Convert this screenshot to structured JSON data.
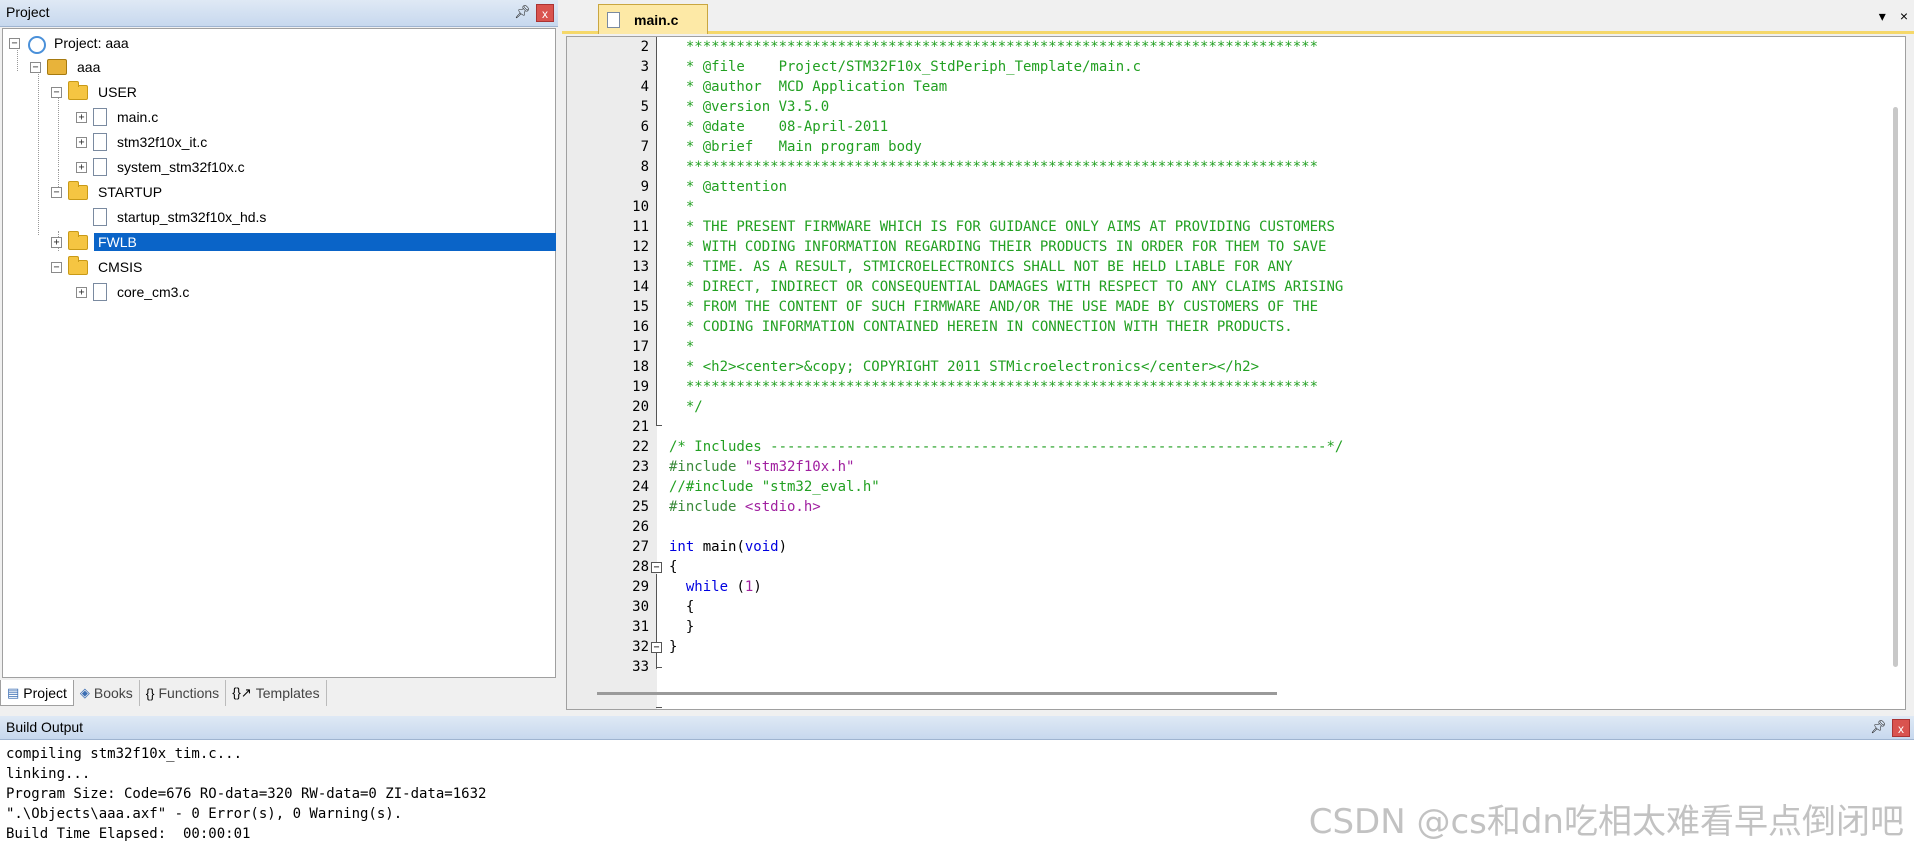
{
  "project_panel": {
    "title": "Project",
    "pin": "p",
    "close": "x",
    "tree": [
      {
        "label": "Project: aaa",
        "icon": "project-icon",
        "expanded": true
      },
      {
        "label": "aaa",
        "icon": "target-icon",
        "expanded": true
      },
      {
        "label": "USER",
        "icon": "folder-icon",
        "expanded": true
      },
      {
        "label": "main.c",
        "icon": "file-icon",
        "expanded": false
      },
      {
        "label": "stm32f10x_it.c",
        "icon": "file-icon",
        "expanded": false
      },
      {
        "label": "system_stm32f10x.c",
        "icon": "file-icon",
        "expanded": false
      },
      {
        "label": "STARTUP",
        "icon": "folder-icon",
        "expanded": true
      },
      {
        "label": "startup_stm32f10x_hd.s",
        "icon": "file-icon"
      },
      {
        "label": "FWLB",
        "icon": "folder-icon",
        "expanded": false,
        "selected": true
      },
      {
        "label": "CMSIS",
        "icon": "folder-icon",
        "expanded": true
      },
      {
        "label": "core_cm3.c",
        "icon": "file-icon",
        "expanded": false
      }
    ],
    "tabs": [
      {
        "label": "Project",
        "icon": "project-tab-icon",
        "active": true
      },
      {
        "label": "Books",
        "icon": "books-icon"
      },
      {
        "label": "Functions",
        "icon": "functions-icon"
      },
      {
        "label": "Templates",
        "icon": "templates-icon"
      }
    ]
  },
  "editor": {
    "tab_label": "main.c",
    "dropdown": "▾",
    "close": "×",
    "lines": [
      {
        "n": "2",
        "html": "<span class='cm'>  ***************************************************************************</span>"
      },
      {
        "n": "3",
        "html": "<span class='cm'>  * @file    Project/STM32F10x_StdPeriph_Template/main.c</span>"
      },
      {
        "n": "4",
        "html": "<span class='cm'>  * @author  MCD Application Team</span>"
      },
      {
        "n": "5",
        "html": "<span class='cm'>  * @version V3.5.0</span>"
      },
      {
        "n": "6",
        "html": "<span class='cm'>  * @date    08-April-2011</span>"
      },
      {
        "n": "7",
        "html": "<span class='cm'>  * @brief   Main program body</span>"
      },
      {
        "n": "8",
        "html": "<span class='cm'>  ***************************************************************************</span>"
      },
      {
        "n": "9",
        "html": "<span class='cm'>  * @attention</span>"
      },
      {
        "n": "10",
        "html": "<span class='cm'>  *</span>"
      },
      {
        "n": "11",
        "html": "<span class='cm'>  * THE PRESENT FIRMWARE WHICH IS FOR GUIDANCE ONLY AIMS AT PROVIDING CUSTOMERS</span>"
      },
      {
        "n": "12",
        "html": "<span class='cm'>  * WITH CODING INFORMATION REGARDING THEIR PRODUCTS IN ORDER FOR THEM TO SAVE</span>"
      },
      {
        "n": "13",
        "html": "<span class='cm'>  * TIME. AS A RESULT, STMICROELECTRONICS SHALL NOT BE HELD LIABLE FOR ANY</span>"
      },
      {
        "n": "14",
        "html": "<span class='cm'>  * DIRECT, INDIRECT OR CONSEQUENTIAL DAMAGES WITH RESPECT TO ANY CLAIMS ARISING</span>"
      },
      {
        "n": "15",
        "html": "<span class='cm'>  * FROM THE CONTENT OF SUCH FIRMWARE AND/OR THE USE MADE BY CUSTOMERS OF THE</span>"
      },
      {
        "n": "16",
        "html": "<span class='cm'>  * CODING INFORMATION CONTAINED HEREIN IN CONNECTION WITH THEIR PRODUCTS.</span>"
      },
      {
        "n": "17",
        "html": "<span class='cm'>  *</span>"
      },
      {
        "n": "18",
        "html": "<span class='cm'>  * &lt;h2&gt;&lt;center&gt;&amp;copy; COPYRIGHT 2011 STMicroelectronics&lt;/center&gt;&lt;/h2&gt;</span>"
      },
      {
        "n": "19",
        "html": "<span class='cm'>  ***************************************************************************</span>"
      },
      {
        "n": "20",
        "html": "<span class='cm'>  */</span>"
      },
      {
        "n": "21",
        "html": ""
      },
      {
        "n": "22",
        "html": "<span class='cm'>/* Includes ------------------------------------------------------------------*/</span>"
      },
      {
        "n": "23",
        "html": "<span class='pp'>#include </span><span class='str'>\"stm32f10x.h\"</span>"
      },
      {
        "n": "24",
        "html": "<span class='cm'>//#include \"stm32_eval.h\"</span>"
      },
      {
        "n": "25",
        "html": "<span class='pp'>#include </span><span class='str'>&lt;stdio.h&gt;</span>"
      },
      {
        "n": "26",
        "html": ""
      },
      {
        "n": "27",
        "html": "<span class='kw'>int</span> main(<span class='kw'>void</span>)"
      },
      {
        "n": "28",
        "html": "{"
      },
      {
        "n": "29",
        "html": "  <span class='kw'>while</span> (<span class='num'>1</span>)"
      },
      {
        "n": "30",
        "html": "  {"
      },
      {
        "n": "31",
        "html": "  }"
      },
      {
        "n": "32",
        "html": "}"
      },
      {
        "n": "33",
        "html": ""
      }
    ]
  },
  "build_output": {
    "title": "Build Output",
    "pin": "p",
    "close": "x",
    "lines": [
      "compiling stm32f10x_tim.c...",
      "linking...",
      "Program Size: Code=676 RO-data=320 RW-data=0 ZI-data=1632",
      "\".\\Objects\\aaa.axf\" - 0 Error(s), 0 Warning(s).",
      "Build Time Elapsed:  00:00:01"
    ]
  },
  "watermark": "CSDN @cs和dn吃相太难看早点倒闭吧"
}
